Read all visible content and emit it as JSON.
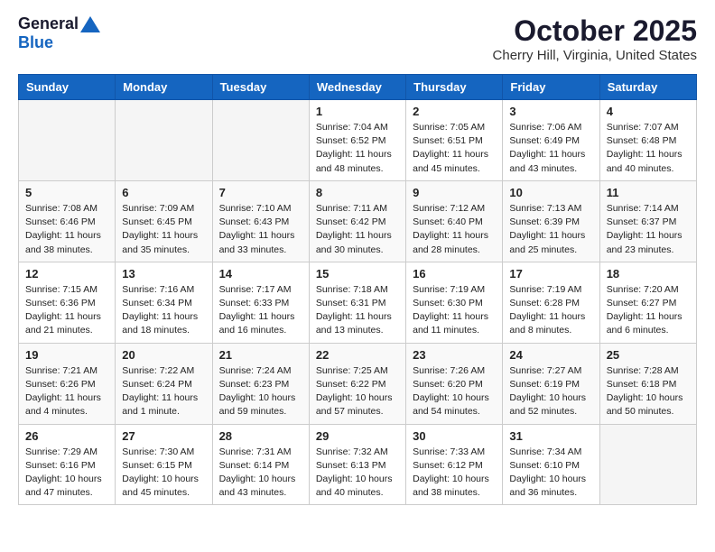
{
  "header": {
    "logo_general": "General",
    "logo_blue": "Blue",
    "month_title": "October 2025",
    "location": "Cherry Hill, Virginia, United States"
  },
  "days_of_week": [
    "Sunday",
    "Monday",
    "Tuesday",
    "Wednesday",
    "Thursday",
    "Friday",
    "Saturday"
  ],
  "weeks": [
    [
      {
        "num": "",
        "info": ""
      },
      {
        "num": "",
        "info": ""
      },
      {
        "num": "",
        "info": ""
      },
      {
        "num": "1",
        "info": "Sunrise: 7:04 AM\nSunset: 6:52 PM\nDaylight: 11 hours and 48 minutes."
      },
      {
        "num": "2",
        "info": "Sunrise: 7:05 AM\nSunset: 6:51 PM\nDaylight: 11 hours and 45 minutes."
      },
      {
        "num": "3",
        "info": "Sunrise: 7:06 AM\nSunset: 6:49 PM\nDaylight: 11 hours and 43 minutes."
      },
      {
        "num": "4",
        "info": "Sunrise: 7:07 AM\nSunset: 6:48 PM\nDaylight: 11 hours and 40 minutes."
      }
    ],
    [
      {
        "num": "5",
        "info": "Sunrise: 7:08 AM\nSunset: 6:46 PM\nDaylight: 11 hours and 38 minutes."
      },
      {
        "num": "6",
        "info": "Sunrise: 7:09 AM\nSunset: 6:45 PM\nDaylight: 11 hours and 35 minutes."
      },
      {
        "num": "7",
        "info": "Sunrise: 7:10 AM\nSunset: 6:43 PM\nDaylight: 11 hours and 33 minutes."
      },
      {
        "num": "8",
        "info": "Sunrise: 7:11 AM\nSunset: 6:42 PM\nDaylight: 11 hours and 30 minutes."
      },
      {
        "num": "9",
        "info": "Sunrise: 7:12 AM\nSunset: 6:40 PM\nDaylight: 11 hours and 28 minutes."
      },
      {
        "num": "10",
        "info": "Sunrise: 7:13 AM\nSunset: 6:39 PM\nDaylight: 11 hours and 25 minutes."
      },
      {
        "num": "11",
        "info": "Sunrise: 7:14 AM\nSunset: 6:37 PM\nDaylight: 11 hours and 23 minutes."
      }
    ],
    [
      {
        "num": "12",
        "info": "Sunrise: 7:15 AM\nSunset: 6:36 PM\nDaylight: 11 hours and 21 minutes."
      },
      {
        "num": "13",
        "info": "Sunrise: 7:16 AM\nSunset: 6:34 PM\nDaylight: 11 hours and 18 minutes."
      },
      {
        "num": "14",
        "info": "Sunrise: 7:17 AM\nSunset: 6:33 PM\nDaylight: 11 hours and 16 minutes."
      },
      {
        "num": "15",
        "info": "Sunrise: 7:18 AM\nSunset: 6:31 PM\nDaylight: 11 hours and 13 minutes."
      },
      {
        "num": "16",
        "info": "Sunrise: 7:19 AM\nSunset: 6:30 PM\nDaylight: 11 hours and 11 minutes."
      },
      {
        "num": "17",
        "info": "Sunrise: 7:19 AM\nSunset: 6:28 PM\nDaylight: 11 hours and 8 minutes."
      },
      {
        "num": "18",
        "info": "Sunrise: 7:20 AM\nSunset: 6:27 PM\nDaylight: 11 hours and 6 minutes."
      }
    ],
    [
      {
        "num": "19",
        "info": "Sunrise: 7:21 AM\nSunset: 6:26 PM\nDaylight: 11 hours and 4 minutes."
      },
      {
        "num": "20",
        "info": "Sunrise: 7:22 AM\nSunset: 6:24 PM\nDaylight: 11 hours and 1 minute."
      },
      {
        "num": "21",
        "info": "Sunrise: 7:24 AM\nSunset: 6:23 PM\nDaylight: 10 hours and 59 minutes."
      },
      {
        "num": "22",
        "info": "Sunrise: 7:25 AM\nSunset: 6:22 PM\nDaylight: 10 hours and 57 minutes."
      },
      {
        "num": "23",
        "info": "Sunrise: 7:26 AM\nSunset: 6:20 PM\nDaylight: 10 hours and 54 minutes."
      },
      {
        "num": "24",
        "info": "Sunrise: 7:27 AM\nSunset: 6:19 PM\nDaylight: 10 hours and 52 minutes."
      },
      {
        "num": "25",
        "info": "Sunrise: 7:28 AM\nSunset: 6:18 PM\nDaylight: 10 hours and 50 minutes."
      }
    ],
    [
      {
        "num": "26",
        "info": "Sunrise: 7:29 AM\nSunset: 6:16 PM\nDaylight: 10 hours and 47 minutes."
      },
      {
        "num": "27",
        "info": "Sunrise: 7:30 AM\nSunset: 6:15 PM\nDaylight: 10 hours and 45 minutes."
      },
      {
        "num": "28",
        "info": "Sunrise: 7:31 AM\nSunset: 6:14 PM\nDaylight: 10 hours and 43 minutes."
      },
      {
        "num": "29",
        "info": "Sunrise: 7:32 AM\nSunset: 6:13 PM\nDaylight: 10 hours and 40 minutes."
      },
      {
        "num": "30",
        "info": "Sunrise: 7:33 AM\nSunset: 6:12 PM\nDaylight: 10 hours and 38 minutes."
      },
      {
        "num": "31",
        "info": "Sunrise: 7:34 AM\nSunset: 6:10 PM\nDaylight: 10 hours and 36 minutes."
      },
      {
        "num": "",
        "info": ""
      }
    ]
  ]
}
